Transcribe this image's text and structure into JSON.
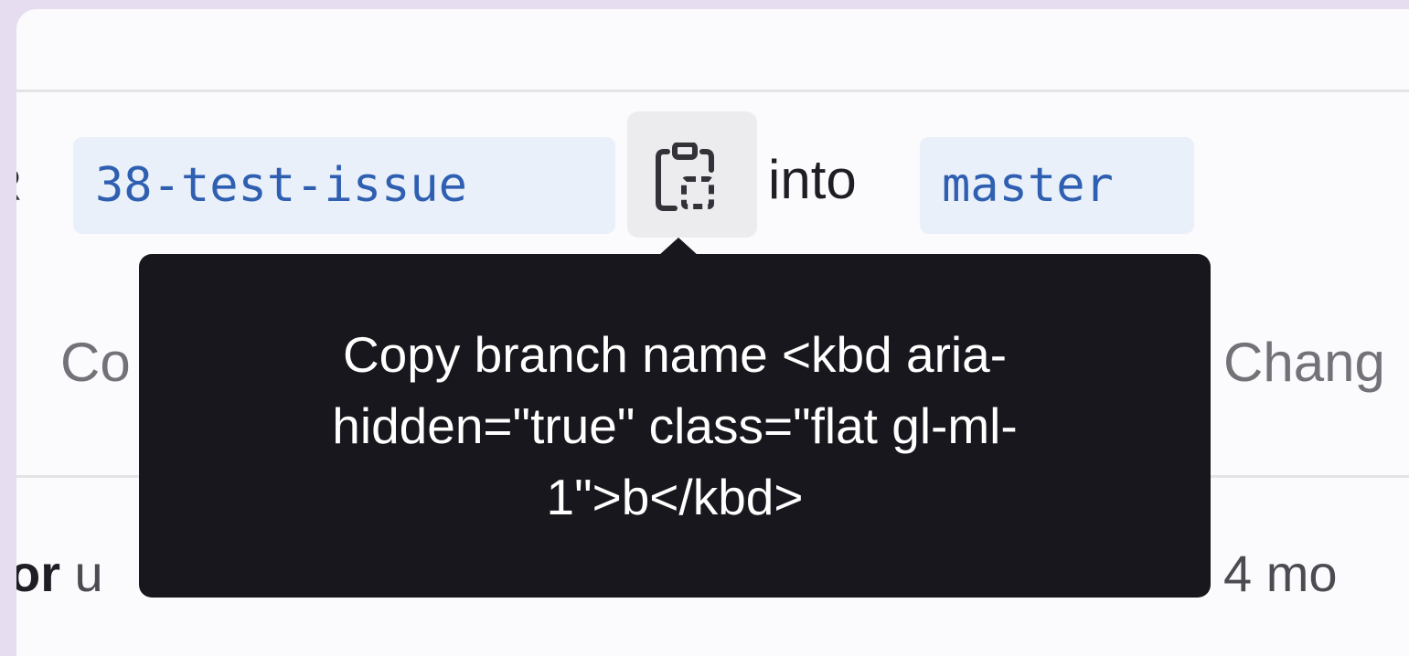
{
  "merge_request": {
    "prefix": "R",
    "source_branch": "38-test-issue",
    "connector": "into",
    "target_branch": "master"
  },
  "copy_button": {
    "icon": "clipboard-icon"
  },
  "tabs_partial": {
    "left": "Co",
    "right": "Chang"
  },
  "footer_partial": {
    "left_bold": "or",
    "left_rest": " u",
    "right": "4 mo"
  },
  "tooltip": {
    "text": "Copy branch name <kbd aria-hidden=\"true\" class=\"flat gl-ml-1\">b</kbd>"
  },
  "colors": {
    "background": "#e6def0",
    "branch_chip_bg": "#e9f0fa",
    "branch_text": "#2f5fb1",
    "tooltip_bg": "#18171d"
  }
}
